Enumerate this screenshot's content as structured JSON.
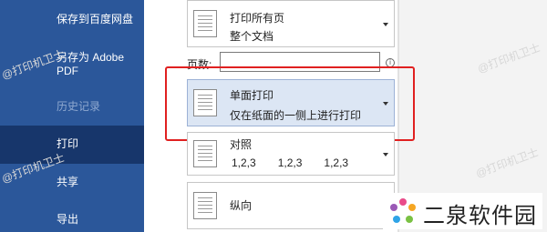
{
  "sidebar": {
    "items": [
      {
        "label": "保存到百度网盘"
      },
      {
        "label": "另存为 Adobe"
      },
      {
        "label": "PDF"
      },
      {
        "label": "历史记录"
      },
      {
        "label": "打印"
      },
      {
        "label": "共享"
      },
      {
        "label": "导出"
      }
    ]
  },
  "settings": {
    "print_range": {
      "title": "打印所有页",
      "subtitle": "整个文档"
    },
    "pages": {
      "label": "页数:",
      "value": ""
    },
    "sides": {
      "title": "单面打印",
      "subtitle": "仅在纸面的一侧上进行打印"
    },
    "collate": {
      "title": "对照",
      "pages": [
        "1,2,3",
        "1,2,3",
        "1,2,3"
      ]
    },
    "orientation": {
      "title": "纵向"
    }
  },
  "watermark": {
    "text": "@打印机卫士"
  },
  "logo": {
    "text": "二泉软件园"
  },
  "colors": {
    "sidebar": "#2b579a",
    "sidebar_active": "#17366b",
    "highlight": "#e02020"
  }
}
